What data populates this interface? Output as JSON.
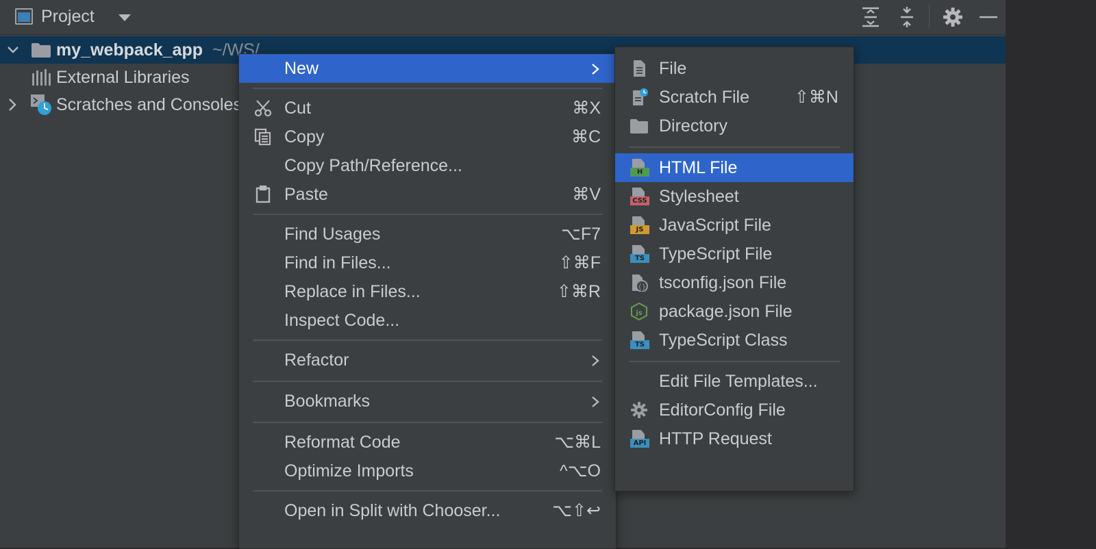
{
  "header": {
    "title": "Project"
  },
  "tree": {
    "root_name": "my_webpack_app",
    "root_path": "~/WS/",
    "items": [
      {
        "label": "External Libraries"
      },
      {
        "label": "Scratches and Consoles"
      }
    ]
  },
  "context_menu": {
    "new": "New",
    "cut": "Cut",
    "cut_sc": "⌘X",
    "copy": "Copy",
    "copy_sc": "⌘C",
    "copy_path": "Copy Path/Reference...",
    "paste": "Paste",
    "paste_sc": "⌘V",
    "find_usages": "Find Usages",
    "find_usages_sc": "⌥F7",
    "find_in_files": "Find in Files...",
    "find_in_files_sc": "⇧⌘F",
    "replace_in_files": "Replace in Files...",
    "replace_in_files_sc": "⇧⌘R",
    "inspect_code": "Inspect Code...",
    "refactor": "Refactor",
    "bookmarks": "Bookmarks",
    "reformat_code": "Reformat Code",
    "reformat_code_sc": "⌥⌘L",
    "optimize_imports": "Optimize Imports",
    "optimize_imports_sc": "^⌥O",
    "open_split": "Open in Split with Chooser...",
    "open_split_sc": "⌥⇧↩"
  },
  "new_submenu": {
    "file": "File",
    "scratch_file": "Scratch File",
    "scratch_file_sc": "⇧⌘N",
    "directory": "Directory",
    "html_file": "HTML File",
    "stylesheet": "Stylesheet",
    "javascript_file": "JavaScript File",
    "typescript_file": "TypeScript File",
    "tsconfig_file": "tsconfig.json File",
    "package_json_file": "package.json File",
    "typescript_class": "TypeScript Class",
    "edit_templates": "Edit File Templates...",
    "editorconfig_file": "EditorConfig File",
    "http_request": "HTTP Request"
  },
  "badges": {
    "html": "H",
    "css": "CSS",
    "js": "JS",
    "ts": "TS",
    "api": "API"
  },
  "colors": {
    "highlight": "#2f65ca",
    "selected_row": "#0f3552",
    "html_badge": "#4f9a52",
    "css_badge": "#c5606a",
    "js_badge": "#d19a31",
    "ts_badge": "#3a8fbf",
    "api_badge": "#3a8fbf"
  }
}
